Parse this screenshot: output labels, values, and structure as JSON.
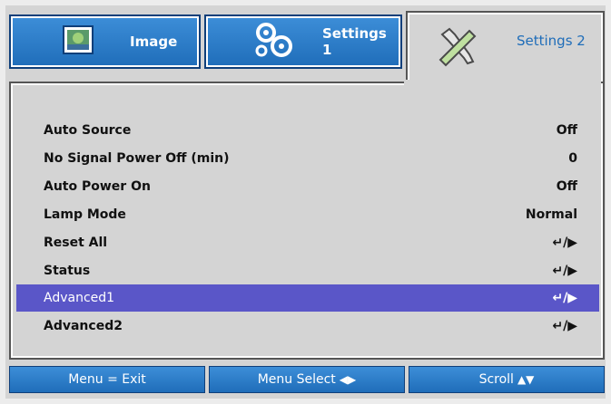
{
  "tabs": [
    {
      "label": "Image",
      "icon": "image-icon"
    },
    {
      "label": "Settings 1",
      "icon": "gears-icon"
    },
    {
      "label": "Settings 2",
      "icon": "tools-icon",
      "active": true
    }
  ],
  "menu": {
    "items": [
      {
        "label": "Auto Source",
        "value": "Off"
      },
      {
        "label": "No Signal Power Off (min)",
        "value": "0"
      },
      {
        "label": "Auto Power On",
        "value": "Off"
      },
      {
        "label": "Lamp Mode",
        "value": "Normal"
      },
      {
        "label": "Reset All",
        "value": "↵/▶"
      },
      {
        "label": "Status",
        "value": "↵/▶"
      },
      {
        "label": "Advanced1",
        "value": "↵/▶",
        "selected": true
      },
      {
        "label": "Advanced2",
        "value": "↵/▶"
      }
    ]
  },
  "footer": {
    "menu_exit": "Menu = Exit",
    "menu_select": "Menu Select",
    "menu_select_arrows": "◀▶",
    "scroll": "Scroll",
    "scroll_arrows": "▲▼"
  },
  "colors": {
    "tab_blue": "#1f6db9",
    "selected_row": "#5a56c8",
    "background": "#d4d4d4"
  }
}
